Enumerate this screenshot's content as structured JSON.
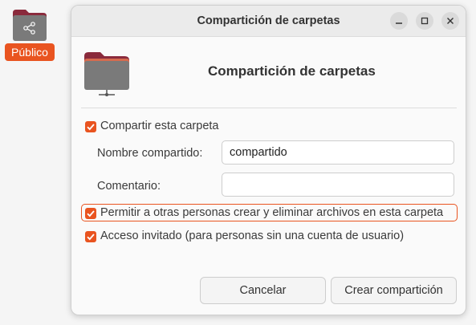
{
  "desktop": {
    "folder_label": "Público",
    "accent": "#e95420"
  },
  "window": {
    "title": "Compartición de carpetas",
    "controls": {
      "minimize": "–",
      "maximize": "□",
      "close": "✕"
    },
    "heading": "Compartición de carpetas",
    "share_checkbox": {
      "label": "Compartir esta carpeta",
      "checked": true
    },
    "share_name": {
      "label": "Nombre compartido:",
      "value": "compartido"
    },
    "comment": {
      "label": "Comentario:",
      "value": ""
    },
    "allow_others_checkbox": {
      "label": "Permitir a otras personas crear y eliminar archivos en esta carpeta",
      "checked": true
    },
    "guest_checkbox": {
      "label": "Acceso invitado (para personas sin una cuenta de usuario)",
      "checked": true
    },
    "buttons": {
      "cancel": "Cancelar",
      "create": "Crear compartición"
    }
  }
}
